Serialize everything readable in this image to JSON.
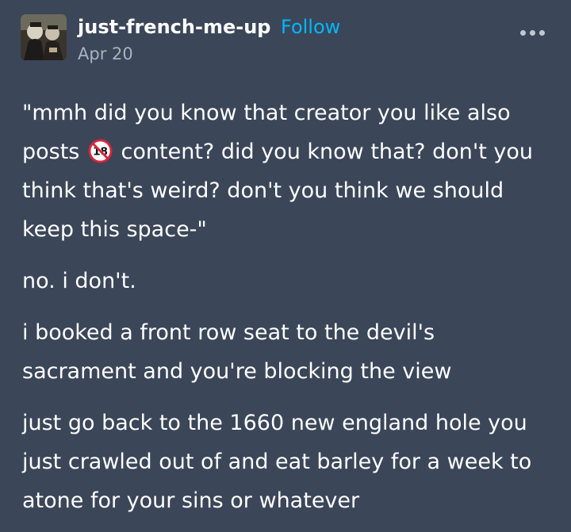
{
  "post": {
    "blog_name": "just-french-me-up",
    "follow_label": "Follow",
    "date": "Apr 20",
    "more_icon": "more-icon",
    "paragraphs": {
      "p1_before": "\"mmh did you know that creator you like also posts ",
      "p1_emoji": "🔞",
      "p1_after": " content? did you know that? don't you think that's weird? don't you think we should keep this space-\"",
      "p2": "no. i don't.",
      "p3": "i booked a front row seat to the devil's sacrament and you're blocking the view",
      "p4": "just go back to the 1660 new england hole you just crawled out of and eat barley for a week to atone for your sins or whatever"
    }
  },
  "colors": {
    "background": "#3b4659",
    "text": "#ffffff",
    "follow": "#00b8ff",
    "date": "#aab2bf"
  }
}
